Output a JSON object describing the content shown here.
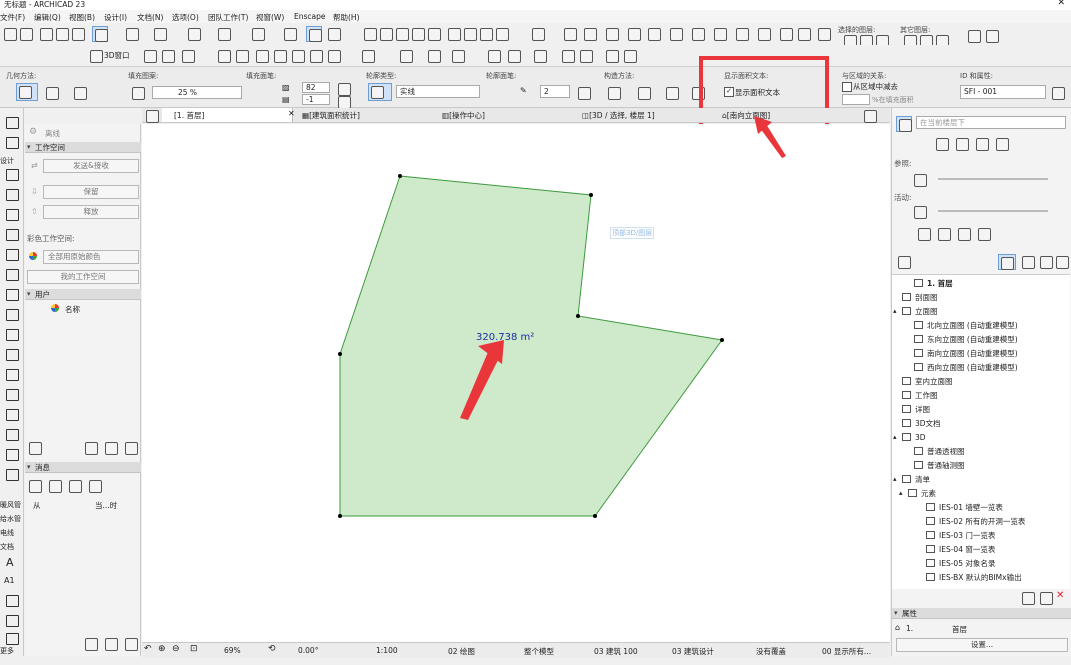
{
  "window": {
    "title": "无标题 - ARCHICAD 23"
  },
  "menu": [
    "文件(F)",
    "编辑(Q)",
    "视图(B)",
    "设计(I)",
    "文档(N)",
    "选项(O)",
    "团队工作(T)",
    "视窗(W)",
    "Enscape",
    "帮助(H)"
  ],
  "toolbar": {
    "view3d_label": "3D窗口",
    "selected_layers_label": "选择的图层:",
    "other_layers_label": "其它图层:"
  },
  "infobox": {
    "geometry_method_label": "几何方法:",
    "fill_pattern_label": "填充图案:",
    "fill_percent": "25 %",
    "fill_area_label": "填充面笔:",
    "pen_fg": "82",
    "pen_bg": "-1",
    "contour_type_label": "轮廓类型:",
    "contour_type_value": "实线",
    "contour_pen_label": "轮廓面笔:",
    "contour_pen_value": "2",
    "build_method_label": "构造方法:",
    "show_area_label": "显示面积文本:",
    "show_area_checkbox_label": "显示面积文本",
    "relation_label": "与区域的关系:",
    "subtract_label": "从区域中减去",
    "fill_area_pct_label": "%在填充面积",
    "id_label": "ID 和属性:",
    "id_value": "SFI - 001"
  },
  "tabs": [
    {
      "label": "[1. 首层]"
    },
    {
      "label": "[建筑面积统计]"
    },
    {
      "label": "[操作中心]"
    },
    {
      "label": "[3D / 选择, 楼层 1]"
    },
    {
      "label": "[南向立面图]"
    }
  ],
  "left_panel": {
    "offline_label": "离线",
    "workspace_header": "工作空间",
    "send_receive": "发送&接收",
    "keep": "保留",
    "release": "释放",
    "color_workspace_label": "彩色工作空间:",
    "color_option": "全部用原始颜色",
    "my_workspace": "我的工作空间",
    "user_header": "用户",
    "user_name_col": "名称",
    "message_header": "消息",
    "msg_from": "从",
    "msg_time": "当...时"
  },
  "toolbox": {
    "tabs": [
      "设计",
      "暖风管",
      "给水管",
      "电线",
      "文档",
      "更多"
    ],
    "text_tool": "A",
    "label_tool": "A1"
  },
  "canvas": {
    "area_text": "320.738 m²",
    "hint_badge": "顶部3D/图层",
    "zoom": "69%",
    "angle": "0.00°",
    "scale": "1:100",
    "layer_combo": "02 绘图",
    "model_view": "整个模型",
    "arch100": "03 建筑 100",
    "design": "03 建筑设计",
    "override": "没有覆盖",
    "show_all": "00 显示所有..."
  },
  "navigator": {
    "placeholder": "在当前楼层下",
    "ref_label": "参照:",
    "active_label": "活动:",
    "items": [
      {
        "label": "1. 首层",
        "level": 1,
        "bold": true
      },
      {
        "label": "剖面图",
        "level": 0
      },
      {
        "label": "立面图",
        "level": 0,
        "expand": true
      },
      {
        "label": "北向立面图 (自动重建模型)",
        "level": 1
      },
      {
        "label": "东向立面图 (自动重建模型)",
        "level": 1
      },
      {
        "label": "南向立面图 (自动重建模型)",
        "level": 1
      },
      {
        "label": "西向立面图 (自动重建模型)",
        "level": 1
      },
      {
        "label": "室内立面图",
        "level": 0
      },
      {
        "label": "工作图",
        "level": 0
      },
      {
        "label": "详图",
        "level": 0
      },
      {
        "label": "3D文档",
        "level": 0
      },
      {
        "label": "3D",
        "level": 0,
        "expand": true
      },
      {
        "label": "普通透视图",
        "level": 1
      },
      {
        "label": "普通轴测图",
        "level": 1
      },
      {
        "label": "清单",
        "level": 0,
        "expand": true
      },
      {
        "label": "元素",
        "level": 0.5,
        "expand": true
      },
      {
        "label": "IES-01 墙壁一览表",
        "level": 2
      },
      {
        "label": "IES-02 所有的开洞一览表",
        "level": 2
      },
      {
        "label": "IES-03 门一览表",
        "level": 2
      },
      {
        "label": "IES-04 窗一览表",
        "level": 2
      },
      {
        "label": "IES-05 对象名录",
        "level": 2
      },
      {
        "label": "IES-BX 默认的BIMx输出",
        "level": 2
      }
    ],
    "props_header": "属性",
    "props_id": "1.",
    "props_name": "首层",
    "settings_button": "设置..."
  },
  "colors": {
    "polygon_fill": "#cfe9cb",
    "polygon_stroke": "#3d9a3d",
    "highlight_red": "#e8363a",
    "area_text": "#1a2fa0"
  }
}
